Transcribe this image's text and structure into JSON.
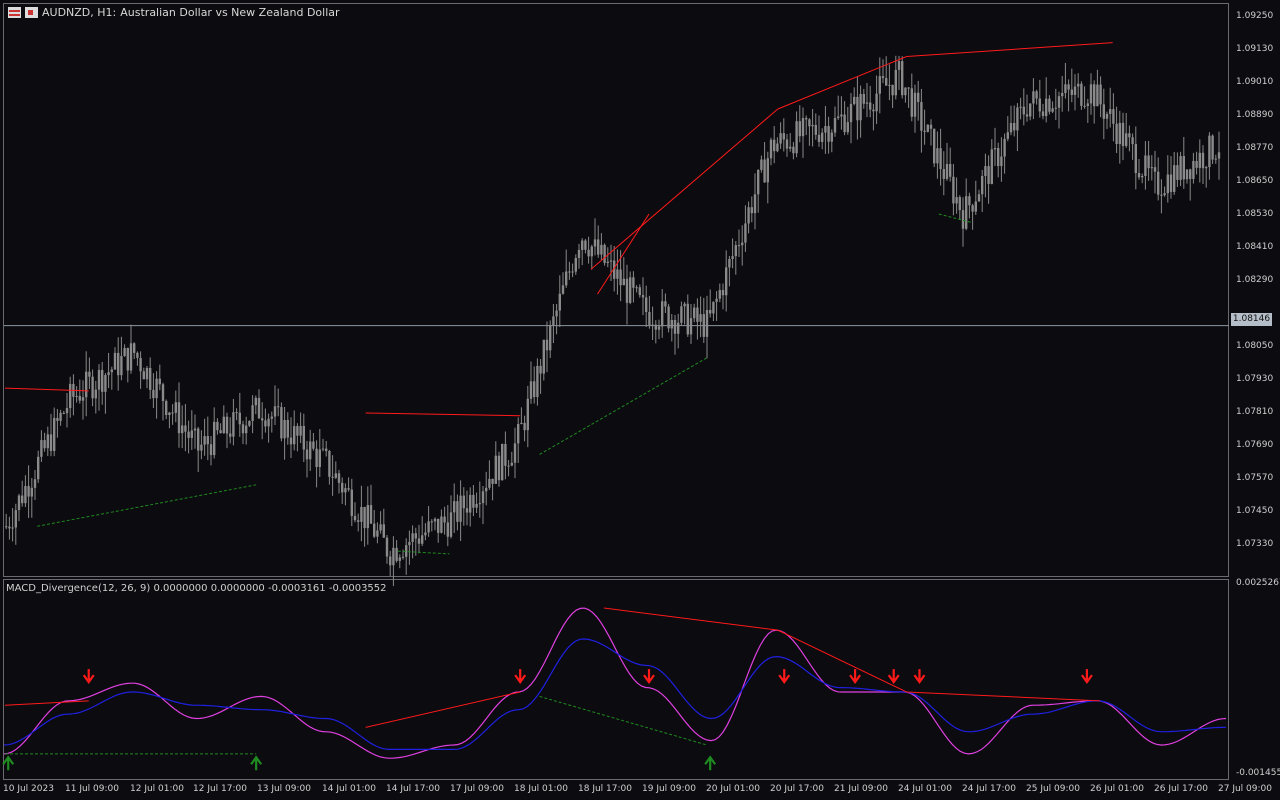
{
  "header": {
    "symbol": "AUDNZD, H1:",
    "description": "Australian Dollar vs New Zealand Dollar"
  },
  "indicator": {
    "title": "MACD_Divergence(12, 26, 9) 0.0000000 0.0000000 -0.0003161 -0.0003552"
  },
  "price_axis": [
    "1.09250",
    "1.09130",
    "1.09010",
    "1.08890",
    "1.08770",
    "1.08650",
    "1.08530",
    "1.08410",
    "1.08290",
    "1.08050",
    "1.07930",
    "1.07810",
    "1.07690",
    "1.07570",
    "1.07450",
    "1.07330"
  ],
  "current_price": "1.08146",
  "indicator_axis": [
    "0.0025267",
    "-0.0014558"
  ],
  "time_axis": [
    "10 Jul 2023",
    "11 Jul 09:00",
    "12 Jul 01:00",
    "12 Jul 17:00",
    "13 Jul 09:00",
    "14 Jul 01:00",
    "14 Jul 17:00",
    "17 Jul 09:00",
    "18 Jul 01:00",
    "18 Jul 17:00",
    "19 Jul 09:00",
    "20 Jul 01:00",
    "20 Jul 17:00",
    "21 Jul 09:00",
    "24 Jul 01:00",
    "24 Jul 17:00",
    "25 Jul 09:00",
    "26 Jul 01:00",
    "26 Jul 17:00",
    "27 Jul 09:00"
  ],
  "colors": {
    "background": "#0b0b10",
    "candle": "#8a8a8a",
    "bearish_divergence": "#ff1a1a",
    "bullish_divergence": "#1f8a1f",
    "macd": "#e040e0",
    "signal": "#2020e0",
    "current_price_line": "#8c97a3"
  },
  "chart_data": [
    {
      "type": "candlestick",
      "symbol": "AUDNZD",
      "timeframe": "H1",
      "title": "Australian Dollar vs New Zealand Dollar",
      "current_price": 1.08146,
      "ylim": [
        1.0724,
        1.0931
      ],
      "close_path": [
        [
          "10 Jul 2023",
          1.0742
        ],
        [
          "11 Jul 09:00",
          1.0788
        ],
        [
          "12 Jul 01:00",
          1.0805
        ],
        [
          "12 Jul 17:00",
          1.077
        ],
        [
          "13 Jul 09:00",
          1.0785
        ],
        [
          "14 Jul 01:00",
          1.0765
        ],
        [
          "14 Jul 17:00",
          1.0733
        ],
        [
          "17 Jul 09:00",
          1.0745
        ],
        [
          "18 Jul 01:00",
          1.0772
        ],
        [
          "18 Jul 17:00",
          1.0848
        ],
        [
          "19 Jul 09:00",
          1.082
        ],
        [
          "20 Jul 01:00",
          1.0815
        ],
        [
          "20 Jul 17:00",
          1.088
        ],
        [
          "21 Jul 09:00",
          1.0888
        ],
        [
          "24 Jul 01:00",
          1.0905
        ],
        [
          "24 Jul 17:00",
          1.0855
        ],
        [
          "25 Jul 09:00",
          1.0895
        ],
        [
          "26 Jul 01:00",
          1.09
        ],
        [
          "26 Jul 17:00",
          1.0865
        ],
        [
          "27 Jul 09:00",
          1.088
        ]
      ],
      "divergence_lines": "bearish (red) connecting higher highs, bullish (green dashed) connecting lower lows"
    },
    {
      "type": "line",
      "title": "MACD_Divergence(12, 26, 9)",
      "ylim": [
        -0.0014558,
        0.0025267
      ],
      "series": [
        {
          "name": "MACD",
          "values": [
            -0.001,
            0.0002,
            0.0006,
            -0.0002,
            0.0003,
            -0.0005,
            -0.0011,
            -0.0008,
            0.0004,
            0.0023,
            0.0005,
            -0.0007,
            0.0018,
            0.0004,
            0.0004,
            -0.001,
            0.0001,
            0.0002,
            -0.0008,
            -0.0002
          ]
        },
        {
          "name": "Signal",
          "values": [
            -0.0008,
            -0.0001,
            0.0004,
            0.0001,
            0.0,
            -0.0002,
            -0.0009,
            -0.0009,
            0.0,
            0.0016,
            0.001,
            -0.0002,
            0.0012,
            0.0005,
            0.0004,
            -0.0005,
            -0.0001,
            0.0002,
            -0.0005,
            -0.0004
          ]
        }
      ],
      "arrows": {
        "bearish_count": 8,
        "bullish_count": 3
      }
    }
  ]
}
